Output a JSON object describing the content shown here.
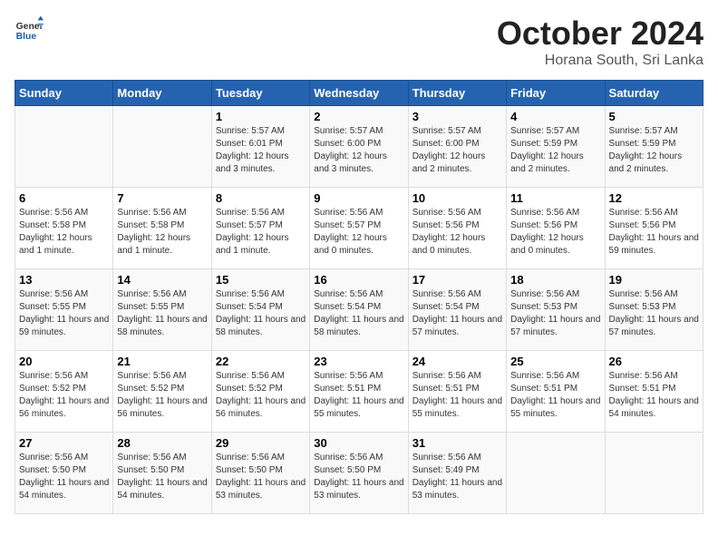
{
  "logo": {
    "text1": "General",
    "text2": "Blue"
  },
  "title": "October 2024",
  "location": "Horana South, Sri Lanka",
  "weekdays": [
    "Sunday",
    "Monday",
    "Tuesday",
    "Wednesday",
    "Thursday",
    "Friday",
    "Saturday"
  ],
  "weeks": [
    [
      {
        "day": "",
        "sunrise": "",
        "sunset": "",
        "daylight": ""
      },
      {
        "day": "",
        "sunrise": "",
        "sunset": "",
        "daylight": ""
      },
      {
        "day": "1",
        "sunrise": "Sunrise: 5:57 AM",
        "sunset": "Sunset: 6:01 PM",
        "daylight": "Daylight: 12 hours and 3 minutes."
      },
      {
        "day": "2",
        "sunrise": "Sunrise: 5:57 AM",
        "sunset": "Sunset: 6:00 PM",
        "daylight": "Daylight: 12 hours and 3 minutes."
      },
      {
        "day": "3",
        "sunrise": "Sunrise: 5:57 AM",
        "sunset": "Sunset: 6:00 PM",
        "daylight": "Daylight: 12 hours and 2 minutes."
      },
      {
        "day": "4",
        "sunrise": "Sunrise: 5:57 AM",
        "sunset": "Sunset: 5:59 PM",
        "daylight": "Daylight: 12 hours and 2 minutes."
      },
      {
        "day": "5",
        "sunrise": "Sunrise: 5:57 AM",
        "sunset": "Sunset: 5:59 PM",
        "daylight": "Daylight: 12 hours and 2 minutes."
      }
    ],
    [
      {
        "day": "6",
        "sunrise": "Sunrise: 5:56 AM",
        "sunset": "Sunset: 5:58 PM",
        "daylight": "Daylight: 12 hours and 1 minute."
      },
      {
        "day": "7",
        "sunrise": "Sunrise: 5:56 AM",
        "sunset": "Sunset: 5:58 PM",
        "daylight": "Daylight: 12 hours and 1 minute."
      },
      {
        "day": "8",
        "sunrise": "Sunrise: 5:56 AM",
        "sunset": "Sunset: 5:57 PM",
        "daylight": "Daylight: 12 hours and 1 minute."
      },
      {
        "day": "9",
        "sunrise": "Sunrise: 5:56 AM",
        "sunset": "Sunset: 5:57 PM",
        "daylight": "Daylight: 12 hours and 0 minutes."
      },
      {
        "day": "10",
        "sunrise": "Sunrise: 5:56 AM",
        "sunset": "Sunset: 5:56 PM",
        "daylight": "Daylight: 12 hours and 0 minutes."
      },
      {
        "day": "11",
        "sunrise": "Sunrise: 5:56 AM",
        "sunset": "Sunset: 5:56 PM",
        "daylight": "Daylight: 12 hours and 0 minutes."
      },
      {
        "day": "12",
        "sunrise": "Sunrise: 5:56 AM",
        "sunset": "Sunset: 5:56 PM",
        "daylight": "Daylight: 11 hours and 59 minutes."
      }
    ],
    [
      {
        "day": "13",
        "sunrise": "Sunrise: 5:56 AM",
        "sunset": "Sunset: 5:55 PM",
        "daylight": "Daylight: 11 hours and 59 minutes."
      },
      {
        "day": "14",
        "sunrise": "Sunrise: 5:56 AM",
        "sunset": "Sunset: 5:55 PM",
        "daylight": "Daylight: 11 hours and 58 minutes."
      },
      {
        "day": "15",
        "sunrise": "Sunrise: 5:56 AM",
        "sunset": "Sunset: 5:54 PM",
        "daylight": "Daylight: 11 hours and 58 minutes."
      },
      {
        "day": "16",
        "sunrise": "Sunrise: 5:56 AM",
        "sunset": "Sunset: 5:54 PM",
        "daylight": "Daylight: 11 hours and 58 minutes."
      },
      {
        "day": "17",
        "sunrise": "Sunrise: 5:56 AM",
        "sunset": "Sunset: 5:54 PM",
        "daylight": "Daylight: 11 hours and 57 minutes."
      },
      {
        "day": "18",
        "sunrise": "Sunrise: 5:56 AM",
        "sunset": "Sunset: 5:53 PM",
        "daylight": "Daylight: 11 hours and 57 minutes."
      },
      {
        "day": "19",
        "sunrise": "Sunrise: 5:56 AM",
        "sunset": "Sunset: 5:53 PM",
        "daylight": "Daylight: 11 hours and 57 minutes."
      }
    ],
    [
      {
        "day": "20",
        "sunrise": "Sunrise: 5:56 AM",
        "sunset": "Sunset: 5:52 PM",
        "daylight": "Daylight: 11 hours and 56 minutes."
      },
      {
        "day": "21",
        "sunrise": "Sunrise: 5:56 AM",
        "sunset": "Sunset: 5:52 PM",
        "daylight": "Daylight: 11 hours and 56 minutes."
      },
      {
        "day": "22",
        "sunrise": "Sunrise: 5:56 AM",
        "sunset": "Sunset: 5:52 PM",
        "daylight": "Daylight: 11 hours and 56 minutes."
      },
      {
        "day": "23",
        "sunrise": "Sunrise: 5:56 AM",
        "sunset": "Sunset: 5:51 PM",
        "daylight": "Daylight: 11 hours and 55 minutes."
      },
      {
        "day": "24",
        "sunrise": "Sunrise: 5:56 AM",
        "sunset": "Sunset: 5:51 PM",
        "daylight": "Daylight: 11 hours and 55 minutes."
      },
      {
        "day": "25",
        "sunrise": "Sunrise: 5:56 AM",
        "sunset": "Sunset: 5:51 PM",
        "daylight": "Daylight: 11 hours and 55 minutes."
      },
      {
        "day": "26",
        "sunrise": "Sunrise: 5:56 AM",
        "sunset": "Sunset: 5:51 PM",
        "daylight": "Daylight: 11 hours and 54 minutes."
      }
    ],
    [
      {
        "day": "27",
        "sunrise": "Sunrise: 5:56 AM",
        "sunset": "Sunset: 5:50 PM",
        "daylight": "Daylight: 11 hours and 54 minutes."
      },
      {
        "day": "28",
        "sunrise": "Sunrise: 5:56 AM",
        "sunset": "Sunset: 5:50 PM",
        "daylight": "Daylight: 11 hours and 54 minutes."
      },
      {
        "day": "29",
        "sunrise": "Sunrise: 5:56 AM",
        "sunset": "Sunset: 5:50 PM",
        "daylight": "Daylight: 11 hours and 53 minutes."
      },
      {
        "day": "30",
        "sunrise": "Sunrise: 5:56 AM",
        "sunset": "Sunset: 5:50 PM",
        "daylight": "Daylight: 11 hours and 53 minutes."
      },
      {
        "day": "31",
        "sunrise": "Sunrise: 5:56 AM",
        "sunset": "Sunset: 5:49 PM",
        "daylight": "Daylight: 11 hours and 53 minutes."
      },
      {
        "day": "",
        "sunrise": "",
        "sunset": "",
        "daylight": ""
      },
      {
        "day": "",
        "sunrise": "",
        "sunset": "",
        "daylight": ""
      }
    ]
  ]
}
